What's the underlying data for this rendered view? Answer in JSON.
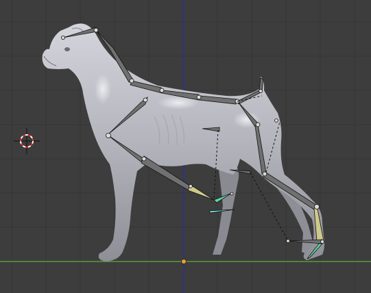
{
  "viewport": {
    "view": "side-orthographic",
    "background": "#3d3d3d",
    "grid_color": "#353535",
    "x_axis_color": "#5a9c3a",
    "z_axis_color": "#2a2e9e"
  },
  "model": {
    "subject": "dog",
    "mesh_color": "#b8b8c0"
  },
  "armature": {
    "bone_color": "#707070",
    "selected_bone_color": "#cfc98a",
    "ik_target_color": "#5fd6a6",
    "pole_target_color": "#7fe0e8"
  },
  "cursor": {
    "icon": "3d-cursor-icon",
    "color": "#e03030"
  },
  "origin": {
    "icon": "object-origin-icon",
    "color": "#e0a030"
  }
}
